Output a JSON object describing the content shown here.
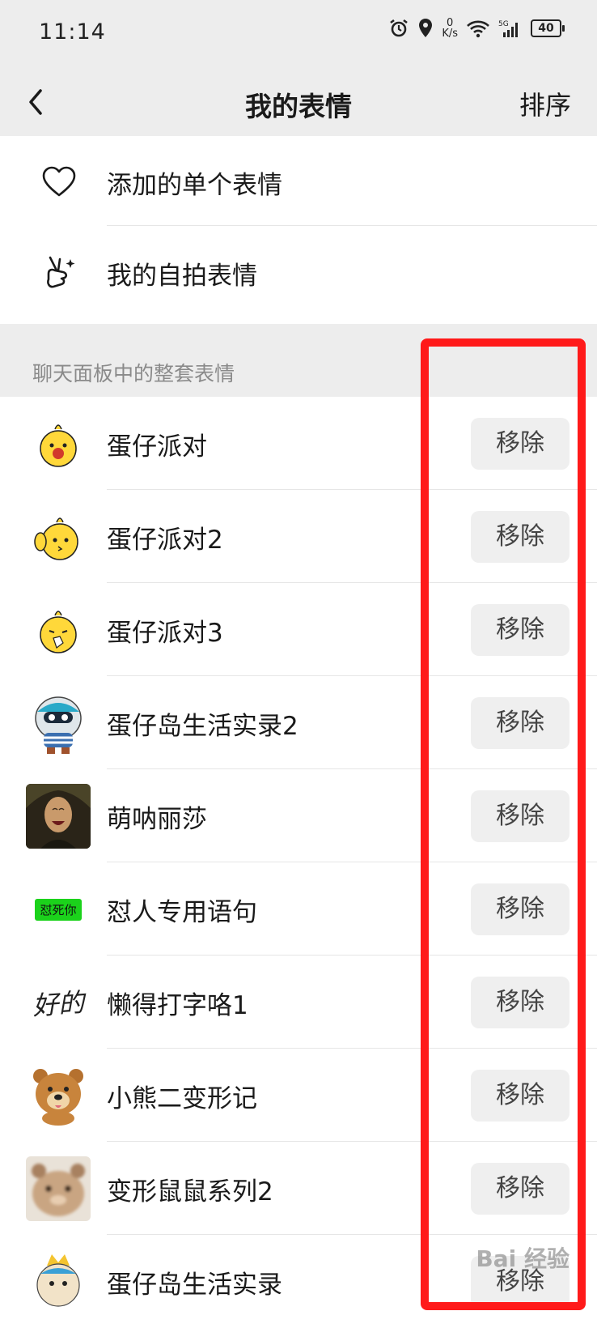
{
  "status": {
    "time": "11:14",
    "net_speed_value": "0",
    "net_speed_unit": "K/s",
    "network": "5G",
    "battery": "40"
  },
  "nav": {
    "title": "我的表情",
    "right_action": "排序"
  },
  "menu": [
    {
      "label": "添加的单个表情",
      "icon": "heart-outline-icon"
    },
    {
      "label": "我的自拍表情",
      "icon": "victory-hand-icon"
    }
  ],
  "section_label": "聊天面板中的整套表情",
  "remove_label": "移除",
  "packs": [
    {
      "name": "蛋仔派对",
      "thumb": "egg-party-chick"
    },
    {
      "name": "蛋仔派对2",
      "thumb": "egg-party-chick-wave"
    },
    {
      "name": "蛋仔派对3",
      "thumb": "egg-party-chick-tissue"
    },
    {
      "name": "蛋仔岛生活实录2",
      "thumb": "eggy-astronaut"
    },
    {
      "name": "萌呐丽莎",
      "thumb": "laughing-mona-lisa"
    },
    {
      "name": "怼人专用语句",
      "thumb": "green-text-badge",
      "thumb_text": "怼死你"
    },
    {
      "name": "懒得打字咯1",
      "thumb": "handwriting-text",
      "thumb_text": "好的"
    },
    {
      "name": "小熊二变形记",
      "thumb": "bear-face"
    },
    {
      "name": "变形鼠鼠系列2",
      "thumb": "blurry-hamster"
    },
    {
      "name": "蛋仔岛生活实录",
      "thumb": "eggy-character"
    }
  ],
  "watermark": "Bai 经验",
  "colors": {
    "header_bg": "#ededed",
    "highlight": "#ff1a1a",
    "green_badge": "#1bd21b",
    "chick_yellow": "#ffd83a"
  }
}
